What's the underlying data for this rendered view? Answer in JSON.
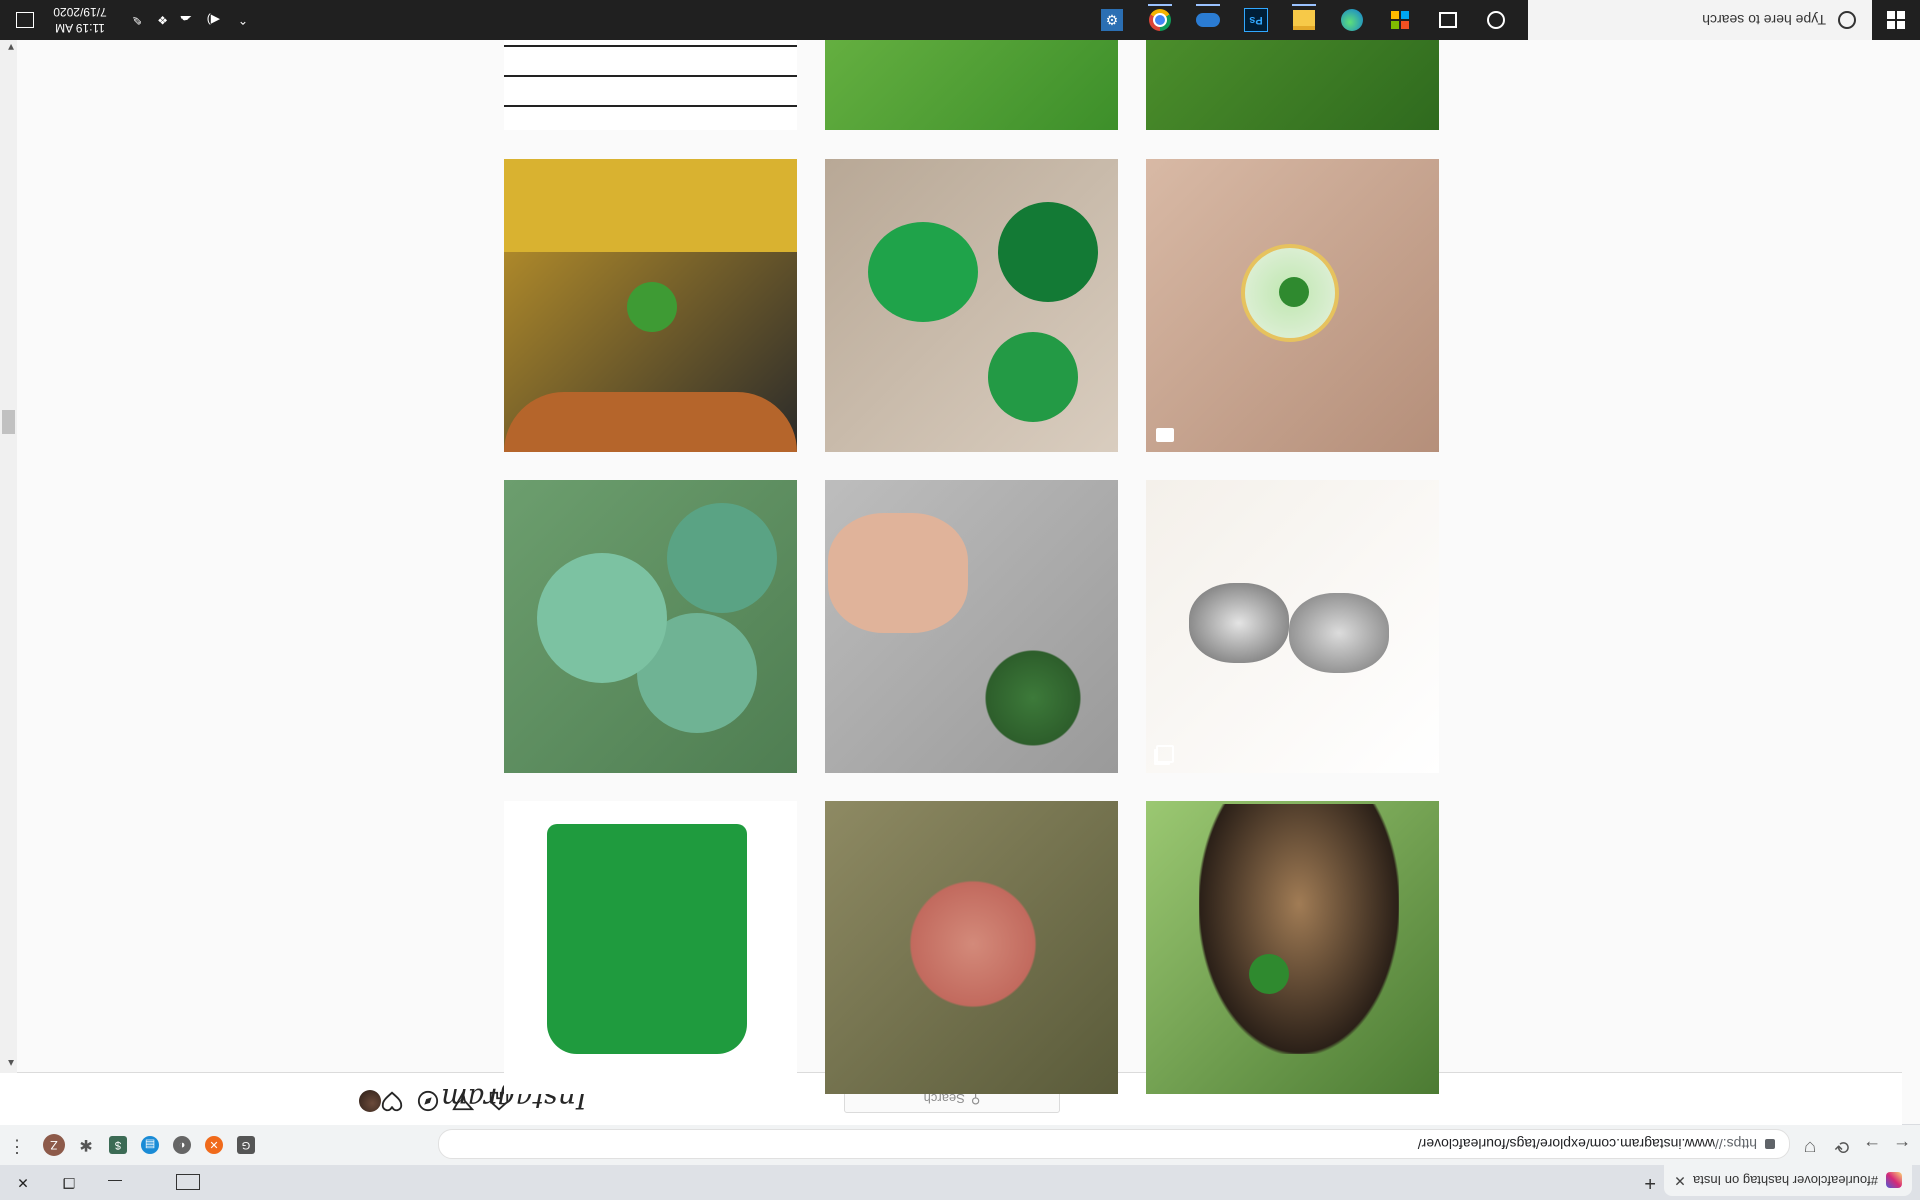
{
  "browser": {
    "tab_title": "#fourleafclover hashtag on Insta",
    "tab_close": "✕",
    "new_tab": "+",
    "window_minimize": "—",
    "window_restore": "❐",
    "window_close": "✕",
    "url_scheme": "https://",
    "url_rest": "www.instagram.com/explore/tags/fourleafclover/",
    "nav_back": "←",
    "nav_forward": "→",
    "nav_reload": "⟳",
    "menu": "⋮",
    "profile_initial": "Z"
  },
  "instagram": {
    "logo": "Instagram",
    "search_placeholder": "Search",
    "search_glyph": "⚲"
  },
  "grid": {
    "tiles": [
      {
        "name": "tile-dog-grass",
        "bg": [
          "#2f6a1e",
          "#5aa132"
        ],
        "extra": "dog"
      },
      {
        "name": "tile-green-blur",
        "bg": [
          "#3d8f2a",
          "#79c04c"
        ],
        "extra": "none"
      },
      {
        "name": "tile-comic",
        "bg": [
          "#f2f2f2",
          "#cfcfcf"
        ],
        "extra": "comic"
      },
      {
        "name": "tile-magnifier-clover",
        "bg": [
          "#b58f7a",
          "#d8b9a5"
        ],
        "extra": "magnifier"
      },
      {
        "name": "tile-green-shamrocks",
        "bg": [
          "#d9cdbf",
          "#b8a896"
        ],
        "extra": "shamrocks"
      },
      {
        "name": "tile-hand-clover-car",
        "bg": [
          "#2a2a2a",
          "#c69a2a"
        ],
        "extra": "handclover"
      },
      {
        "name": "tile-silver-earrings",
        "bg": [
          "#ffffff",
          "#f4f0ea"
        ],
        "extra": "earrings"
      },
      {
        "name": "tile-hand-clover-pavement",
        "bg": [
          "#9a9a9a",
          "#bdbdbd"
        ],
        "extra": "pavementclover"
      },
      {
        "name": "tile-clover-leaves",
        "bg": [
          "#4f7e52",
          "#6c9e6e"
        ],
        "extra": "leaves"
      },
      {
        "name": "tile-dog-clover",
        "bg": [
          "#4c7b33",
          "#9bc872"
        ],
        "extra": "dog2"
      },
      {
        "name": "tile-pink-clover",
        "bg": [
          "#5a5b3a",
          "#8e8a63"
        ],
        "extra": "pink"
      },
      {
        "name": "tile-green-onesie",
        "bg": [
          "#ffffff",
          "#ffffff"
        ],
        "extra": "onesie"
      }
    ]
  },
  "taskbar": {
    "search_placeholder": "Type here to search",
    "time": "11:19 AM",
    "date": "7/19/2020",
    "tray_chevron": "^"
  },
  "colors": {
    "clover_green": "#2f8a2f",
    "taskbar": "#202020"
  }
}
